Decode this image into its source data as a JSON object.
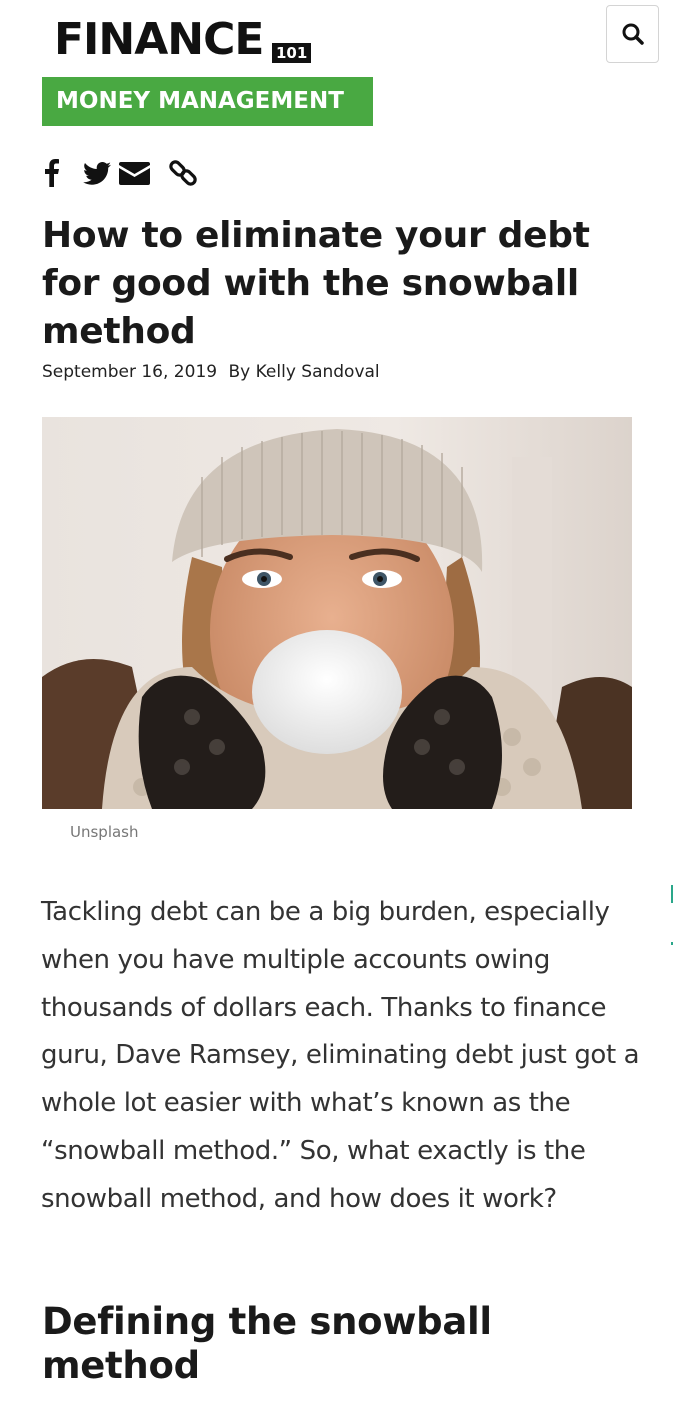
{
  "header": {
    "logo_text": "FINANCE",
    "logo_badge": "101",
    "search_icon": "search-icon"
  },
  "article": {
    "category": "MONEY MANAGEMENT",
    "share_icons": [
      "facebook-icon",
      "twitter-icon",
      "email-icon",
      "link-icon"
    ],
    "title": "How to eliminate your debt for good with the snowball method",
    "date": "September 16, 2019",
    "author": "By Kelly Sandoval",
    "image_caption": "Unsplash",
    "intro": "Tackling debt can be a big burden, especially when you have multiple accounts owing thousands of dollars each. Thanks to finance guru, Dave Ramsey, eliminating debt just got a whole lot easier with what’s known as the “snowball method.” So, what exactly is the snowball method, and how does it work?",
    "section_heading": "Defining the snowball method"
  },
  "colors": {
    "brand_green": "#49a942",
    "text_dark": "#1a1a1a",
    "body_text": "#333333"
  }
}
